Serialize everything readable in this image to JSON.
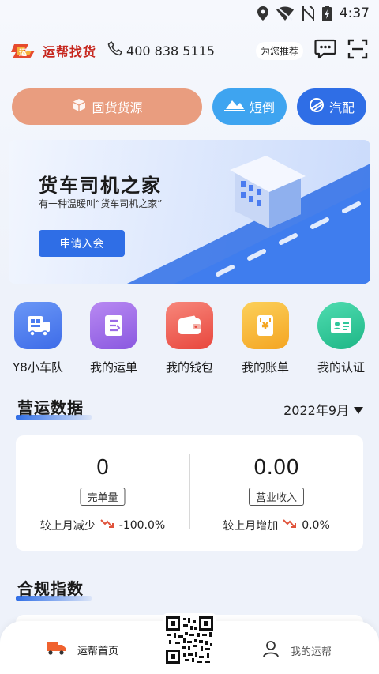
{
  "status_bar": {
    "time": "4:37"
  },
  "header": {
    "app_name": "运帮找货",
    "phone": "400 838 5115",
    "recommend_label": "为您推荐"
  },
  "top_pills": {
    "cargo_label": "固货货源",
    "short_label": "短倒",
    "parts_label": "汽配"
  },
  "banner": {
    "title": "货车司机之家",
    "subtitle": "有一种温暖叫“货车司机之家”",
    "button_label": "申请入会"
  },
  "quick_menu": [
    {
      "label": "Y8小车队",
      "icon": "truck-fleet-icon",
      "color": "#4b7cf0"
    },
    {
      "label": "我的运单",
      "icon": "waybill-icon",
      "color": "#9b6ae6"
    },
    {
      "label": "我的钱包",
      "icon": "wallet-icon",
      "color": "#ee5f55"
    },
    {
      "label": "我的账单",
      "icon": "bill-icon",
      "color": "#f5b732"
    },
    {
      "label": "我的认证",
      "icon": "id-card-icon",
      "color": "#2fc69a"
    }
  ],
  "operations": {
    "section_title": "营运数据",
    "month": "2022年9月",
    "completed": {
      "value": "0",
      "label": "完单量",
      "compare_label": "较上月减少",
      "compare_value": "-100.0%"
    },
    "revenue": {
      "value": "0.00",
      "label": "营业收入",
      "compare_label": "较上月增加",
      "compare_value": "0.0%"
    }
  },
  "compliance": {
    "section_title": "合规指数"
  },
  "bottom_nav": {
    "home_label": "运帮首页",
    "mine_label": "我的运帮"
  },
  "colors": {
    "primary": "#2f6ee6",
    "cargo_pill": "#e99d7f",
    "short_pill": "#3ea4f0",
    "logo_red": "#c6261d",
    "trend_down": "#e0533b"
  }
}
